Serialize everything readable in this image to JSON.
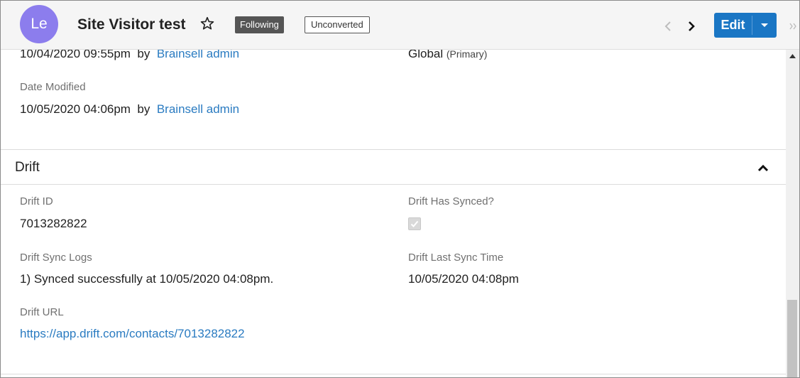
{
  "header": {
    "avatar_initials": "Le",
    "title": "Site Visitor test",
    "following_badge": "Following",
    "status_badge": "Unconverted",
    "edit_label": "Edit"
  },
  "record": {
    "created_value": "10/04/2020 09:55pm",
    "by_label": "by",
    "created_by": "Brainsell admin",
    "team_value": "Global",
    "team_note": "(Primary)",
    "date_modified_label": "Date Modified",
    "modified_value": "10/05/2020 04:06pm",
    "modified_by": "Brainsell admin"
  },
  "drift": {
    "section_title": "Drift",
    "id_label": "Drift ID",
    "id_value": "7013282822",
    "has_synced_label": "Drift Has Synced?",
    "has_synced_checked": true,
    "sync_logs_label": "Drift Sync Logs",
    "sync_logs_value": "1) Synced successfully at 10/05/2020 04:08pm.",
    "last_sync_label": "Drift Last Sync Time",
    "last_sync_value": "10/05/2020 04:08pm",
    "url_label": "Drift URL",
    "url_value": "https://app.drift.com/contacts/7013282822"
  },
  "colors": {
    "accent": "#1a76c4",
    "avatar": "#8c7ded",
    "link": "#2a7bc1"
  },
  "icons": [
    "star-icon",
    "chevron-left-icon",
    "chevron-right-icon",
    "caret-down-icon",
    "double-chevron-right-icon",
    "chevron-up-icon",
    "scroll-up-arrow-icon"
  ]
}
